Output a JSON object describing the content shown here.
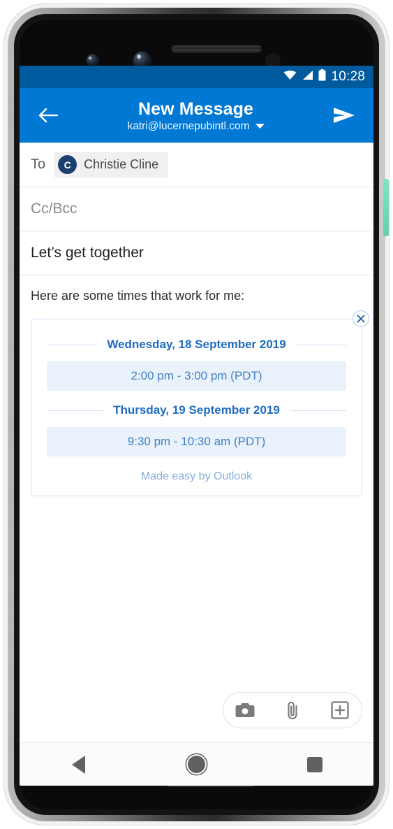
{
  "status_bar": {
    "time": "10:28",
    "icons": [
      "wifi-icon",
      "cellular-signal-icon",
      "battery-icon"
    ]
  },
  "app_bar": {
    "back_icon": "back-arrow-icon",
    "title": "New Message",
    "account": "katri@lucernepubintl.com",
    "account_dropdown_icon": "chevron-down-icon",
    "send_icon": "send-icon"
  },
  "compose": {
    "to_label": "To",
    "recipient": {
      "initial": "C",
      "name": "Christie Cline"
    },
    "cc_bcc_placeholder": "Cc/Bcc",
    "subject": "Let’s get together",
    "body_text": "Here are some times that work for me:"
  },
  "meeting_card": {
    "close_icon": "close-icon",
    "groups": [
      {
        "date": "Wednesday, 18 September 2019",
        "slots": [
          "2:00 pm - 3:00 pm (PDT)"
        ]
      },
      {
        "date": "Thursday, 19 September 2019",
        "slots": [
          "9:30 pm - 10:30 am (PDT)"
        ]
      }
    ],
    "footer": "Made easy by Outlook"
  },
  "attach_bar": {
    "buttons": [
      {
        "name": "camera-icon"
      },
      {
        "name": "paperclip-icon"
      },
      {
        "name": "add-attachment-icon"
      }
    ]
  },
  "nav_bar": {
    "back": "nav-back-icon",
    "home": "nav-home-icon",
    "recents": "nav-recents-icon"
  },
  "colors": {
    "accent": "#0078d4",
    "status_bar": "#005a9e",
    "card_border": "#cfe1f5",
    "slot_bg": "#e9f1fb",
    "date_text": "#1f6bc0",
    "slot_text": "#4180c4",
    "footer_text": "#83aede",
    "avatar_bg": "#1b3f6e",
    "power_button": "#6fdcb8"
  }
}
